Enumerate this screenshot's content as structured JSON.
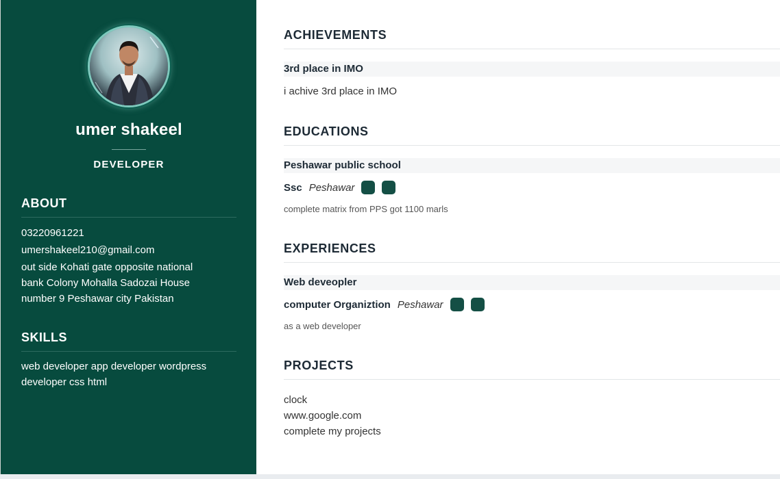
{
  "profile": {
    "name": "umer shakeel",
    "role": "DEVELOPER"
  },
  "about": {
    "heading": "ABOUT",
    "phone": "03220961221",
    "email": "umershakeel210@gmail.com",
    "address_lines": [
      "out side Kohati gate opposite national",
      "bank Colony Mohalla Sadozai House",
      "number 9 Peshawar city Pakistan"
    ]
  },
  "skills": {
    "heading": "SKILLS",
    "lines": [
      "web developer app developer wordpress",
      "developer css html"
    ]
  },
  "achievements": {
    "heading": "ACHIEVEMENTS",
    "title": "3rd place in IMO",
    "description": "i achive 3rd place in IMO"
  },
  "educations": {
    "heading": "EDUCATIONS",
    "title": "Peshawar public school",
    "degree": "Ssc",
    "location": "Peshawar",
    "description": "complete matrix from PPS got 1100 marls"
  },
  "experiences": {
    "heading": "EXPERIENCES",
    "title": "Web deveopler",
    "company": "computer Organiztion",
    "location": "Peshawar",
    "description": "as a web developer"
  },
  "projects": {
    "heading": "PROJECTS",
    "items": [
      "clock",
      "www.google.com",
      "complete my projects"
    ]
  },
  "colors": {
    "sidebar": "#074b3e",
    "badge": "#144f45"
  }
}
